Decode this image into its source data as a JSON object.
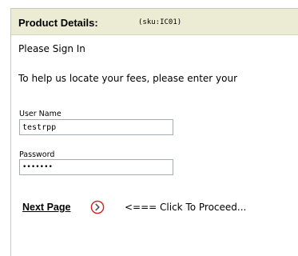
{
  "header": {
    "title": "Product Details:",
    "sku": "(sku:IC01)"
  },
  "content": {
    "sign_in": "Please Sign In",
    "help_text": "To help us locate your fees, please enter your"
  },
  "form": {
    "username_label": "User Name",
    "username_value": "testrpp",
    "password_label": "Password",
    "password_value": "•••••••"
  },
  "footer": {
    "next_label": "Next Page",
    "proceed_hint": "<=== Click To Proceed..."
  },
  "colors": {
    "header_background": "#ecebd3",
    "icon_accent": "#d22020"
  },
  "icons": {
    "next": "circle-arrow-right-icon"
  }
}
